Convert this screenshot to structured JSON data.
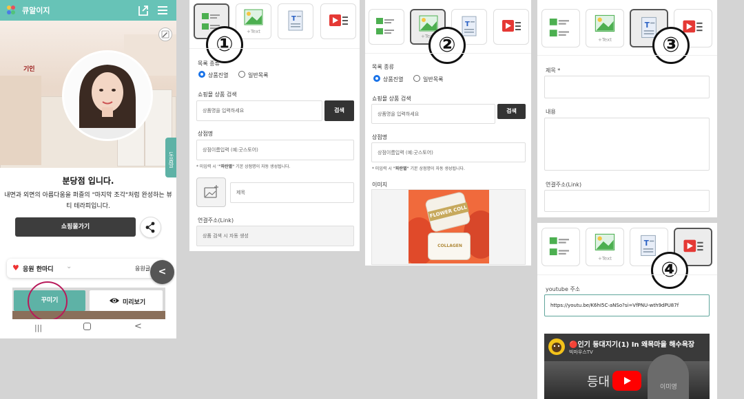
{
  "phone": {
    "app_title": "큐알이지",
    "branch_name": "분당점 입니다.",
    "intro_text": "내면과 외면의 아름다움을 퍼즐의 \"마지막 조각\"처럼 완성하는 뷰티 테라피입니다.",
    "shop_button": "쇼핑몰가기",
    "side_tab": "도움말",
    "cheer_label": "응원 한마디",
    "cheer_right": "응원글쓰",
    "decorate_button": "꾸미기",
    "preview_button": "미리보기",
    "brand_colors": {
      "teal": "#67c3b7",
      "highlight": "#b8195a",
      "dark": "#3d3d3d"
    }
  },
  "panel1": {
    "marker": "①",
    "tile_text": "+Text",
    "list_type_label": "목록 종류",
    "radio_product": "상품진열",
    "radio_general": "일반목록",
    "search_label": "쇼핑몰 상품 검색",
    "search_placeholder": "상품명을 입력하세요",
    "search_button": "검색",
    "shop_name_label": "상점명",
    "shop_name_placeholder": "상점이름입력 (예:굿스토어)",
    "shop_note_prefix": "* 미입력 시 '",
    "shop_note_bold": "\"파란별\"",
    "shop_note_suffix": " 기본 상점명이 자동 생성됩니다.",
    "title_placeholder": "제목",
    "link_label": "연결주소(Link)",
    "link_placeholder": "상품 검색 시 자동 생성"
  },
  "panel2": {
    "marker": "②",
    "tile_text": "+Text",
    "list_type_label": "목록 종류",
    "radio_product": "상품진열",
    "radio_general": "일반목록",
    "search_label": "쇼핑몰 상품 검색",
    "search_placeholder": "상품명을 입력하세요",
    "search_button": "검색",
    "shop_name_label": "상점명",
    "shop_name_placeholder": "상점이름입력 (예:굿스토어)",
    "shop_note_prefix": "* 미입력 시 ",
    "shop_note_bold": "\"파란별\"",
    "shop_note_suffix": " 기본 상점명이 자동 생성됩니다.",
    "image_label": "이미지",
    "product_text_1": "FLOWER COLL",
    "product_text_2": "COLLAGEN"
  },
  "panel3": {
    "marker": "③",
    "tile_text": "+Text",
    "title_label": "제목 *",
    "content_label": "내용",
    "link_label": "연결주소(Link)"
  },
  "panel4": {
    "marker": "④",
    "tile_text": "+Text",
    "youtube_label": "youtube 주소",
    "youtube_url": "https://youtu.be/K6hI5C-aNSo?si=VfPNU-wth9dPU87f",
    "video_title": "🔴인기 등대지기(1) In 왜목마을 해수욕장",
    "channel_name": "빅마우스TV",
    "video_overlay_text": "등대",
    "video_overlay_text2": "이미영"
  }
}
